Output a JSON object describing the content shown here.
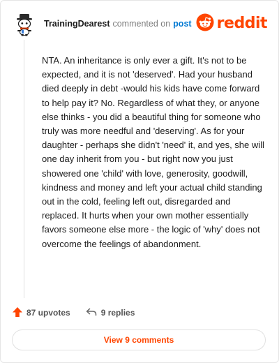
{
  "comment": {
    "username": "TrainingDearest",
    "action_text": "commented on",
    "post_link": "post",
    "body": "NTA. An inheritance is only ever a gift. It's not to be expected, and it is not 'deserved'. Had your husband died deeply in debt -would his kids have come forward to help pay it? No. Regardless of what they, or anyone else thinks - you did a beautiful thing for someone who truly was more needful and 'deserving'. As for your daughter - perhaps she didn't 'need' it, and yes, she will one day inherit from you - but right now you just showered one 'child' with love, generosity, goodwill, kindness and money and left your actual child standing out in the cold, feeling left out, disregarded and replaced. It hurts when your own mother essentially favors someone else more - the logic of 'why' does not overcome the feelings of abandonment."
  },
  "brand": {
    "wordmark": "reddit",
    "accent_color": "#ff4500"
  },
  "actions": {
    "upvotes": "87 upvotes",
    "replies": "9 replies"
  },
  "footer": {
    "view_comments": "View 9 comments"
  },
  "icons": {
    "avatar": "snoo-avatar-icon",
    "logo": "reddit-logo-icon",
    "upvote": "upvote-arrow-icon",
    "reply": "reply-arrow-icon"
  }
}
